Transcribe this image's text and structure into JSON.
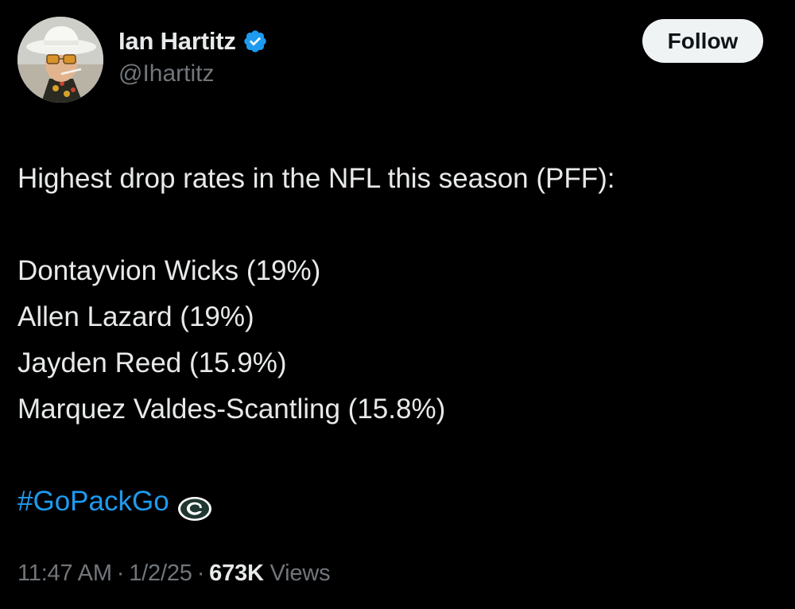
{
  "author": {
    "display_name": "Ian Hartitz",
    "handle": "@Ihartitz",
    "verified_icon": "verified-badge-icon",
    "avatar_icon": "profile-photo"
  },
  "follow_label": "Follow",
  "tweet": {
    "intro": "Highest drop rates in the NFL this season (PFF):",
    "players": [
      "Dontayvion Wicks (19%)",
      "Allen Lazard (19%)",
      "Jayden Reed (15.9%)",
      "Marquez Valdes-Scantling (15.8%)"
    ],
    "hashtag": "#GoPackGo",
    "hashtag_emoji": "green-bay-packers-logo"
  },
  "meta": {
    "time": "11:47 AM",
    "separator": "·",
    "date": "1/2/25",
    "views_count": "673K",
    "views_label": "Views"
  },
  "colors": {
    "background": "#000000",
    "primary_text": "#e7e9ea",
    "secondary_text": "#71767b",
    "link": "#1d9bf0",
    "follow_bg": "#eff3f4"
  }
}
